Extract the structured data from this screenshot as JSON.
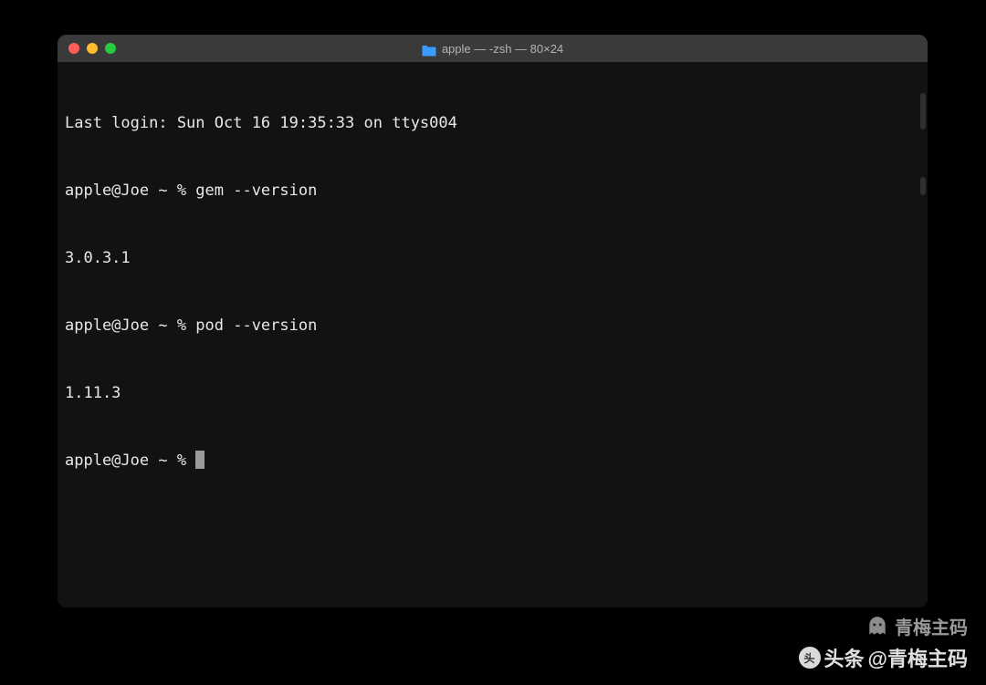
{
  "window": {
    "title": "apple — -zsh — 80×24"
  },
  "terminal": {
    "lines": [
      "Last login: Sun Oct 16 19:35:33 on ttys004",
      "apple@Joe ~ % gem --version",
      "3.0.3.1",
      "apple@Joe ~ % pod --version",
      "1.11.3"
    ],
    "current_prompt": "apple@Joe ~ % "
  },
  "watermark": {
    "top_text": "青梅主码",
    "bottom_prefix": "头条",
    "bottom_text": "@青梅主码"
  },
  "colors": {
    "window_bg": "#1e1e1e",
    "titlebar_bg": "#3a3a3a",
    "body_bg": "#121212",
    "text": "#e8e8e8",
    "close": "#ff5f57",
    "minimize": "#febc2e",
    "maximize": "#28c840"
  }
}
